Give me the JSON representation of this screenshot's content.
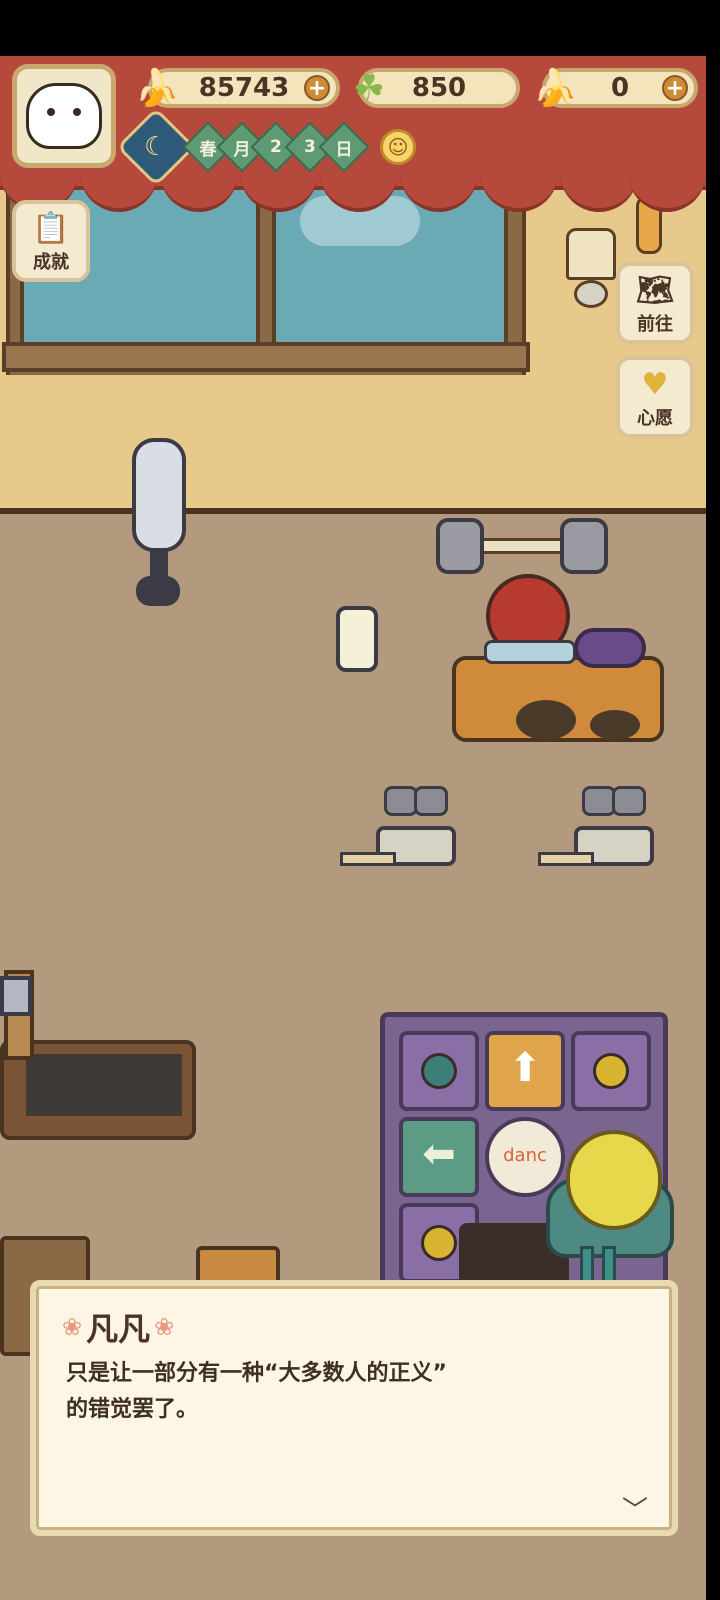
{
  "hud": {
    "bananas": "85743",
    "clovers": "850",
    "blue_bananas": "0",
    "date_chips": [
      "春",
      "月",
      "2",
      "3",
      "日"
    ]
  },
  "side_buttons": {
    "achievement": "成就",
    "goto": "前往",
    "wish": "心愿"
  },
  "dance_pad": {
    "logo_text": "danc"
  },
  "dialog": {
    "speaker": "凡凡",
    "text": "只是让一部分有一种“大多数人的正义”\n的错觉罢了。"
  },
  "icons": {
    "banana": "banana-icon",
    "clover": "clover-icon",
    "blue_banana": "blue-banana-icon",
    "plus": "plus-icon",
    "moon": "moon-icon",
    "weather": "sun-icon",
    "next": "chevron-down-icon"
  },
  "colors": {
    "curtain": "#b5493b",
    "wall": "#e6c98b",
    "floor": "#b39a7e",
    "dialog_bg": "#fdf6e4"
  }
}
